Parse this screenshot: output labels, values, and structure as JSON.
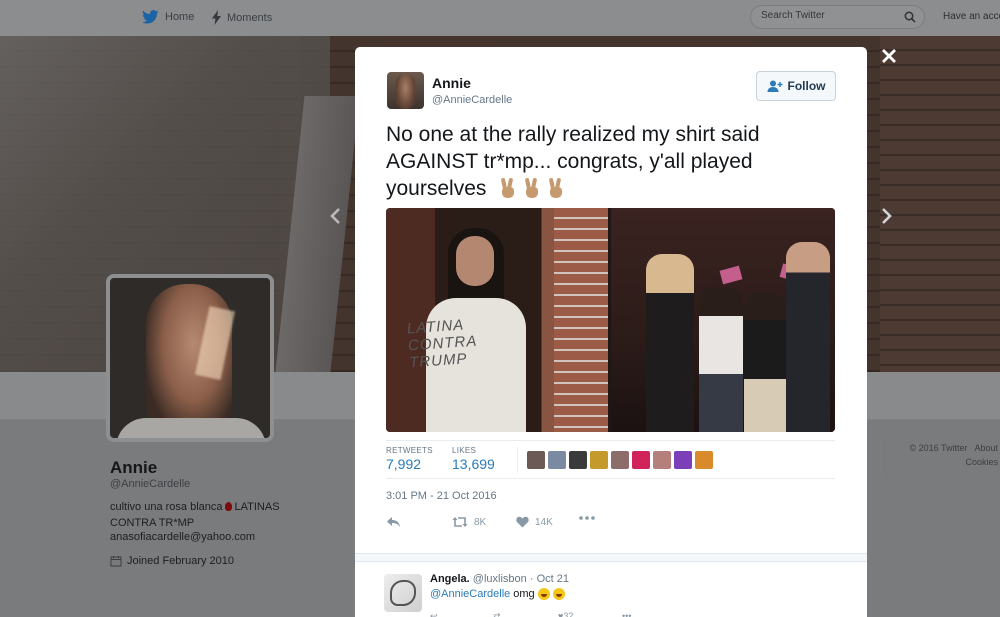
{
  "topbar": {
    "home_label": "Home",
    "moments_label": "Moments",
    "search_placeholder": "Search Twitter",
    "account_text": "Have an accc"
  },
  "profile": {
    "name": "Annie",
    "handle": "@AnnieCardelle",
    "bio_part1": "cultivo una rosa blanca",
    "bio_part2": "LATINAS CONTRA TR*MP",
    "email": "anasofiacardelle@yahoo.com",
    "joined": "Joined February 2010"
  },
  "footer": {
    "copyright": "© 2016 Twitter",
    "about": "About",
    "cookies": "Cookies"
  },
  "tweet": {
    "name": "Annie",
    "handle": "@AnnieCardelle",
    "follow_label": "Follow",
    "text": "No one at the rally realized my shirt said AGAINST tr*mp... congrats, y'all played yourselves",
    "shirt_text": "LATINA CONTRA TRUMP",
    "retweets_label": "RETWEETS",
    "retweets_value": "7,992",
    "likes_label": "LIKES",
    "likes_value": "13,699",
    "timestamp": "3:01 PM - 21 Oct 2016",
    "retweet_count_short": "8K",
    "like_count_short": "14K",
    "liker_colors": [
      "#6b5a55",
      "#7a8aa0",
      "#3a3a3a",
      "#c49a2a",
      "#8b6d6b",
      "#d1245a",
      "#b6807a",
      "#7b3fb8",
      "#d98a2b"
    ]
  },
  "reply": {
    "name": "Angela.",
    "handle": "@luxlisbon",
    "time": "Oct 21",
    "mention": "@AnnieCardelle",
    "text": "omg",
    "like_count": "32"
  }
}
